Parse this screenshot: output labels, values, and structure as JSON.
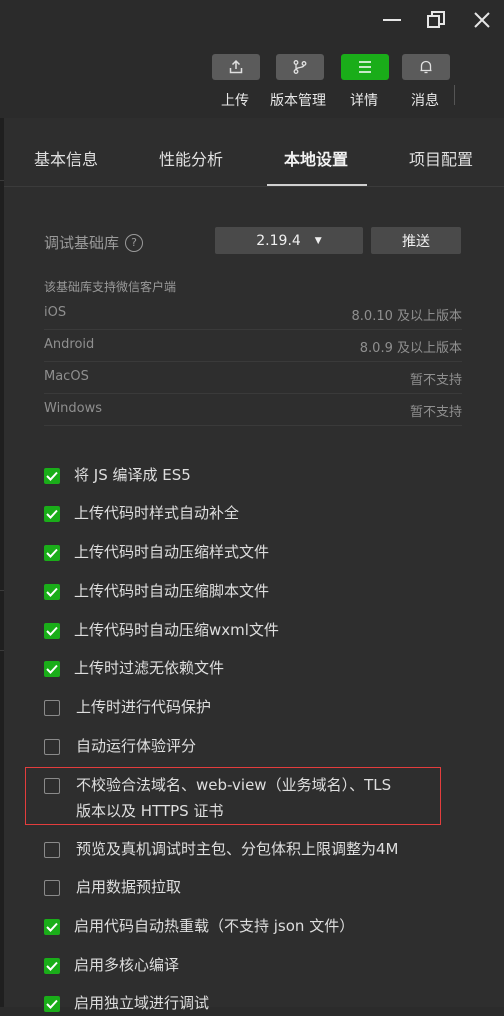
{
  "toolbar": {
    "upload_label": "上传",
    "version_label": "版本管理",
    "details_label": "详情",
    "messages_label": "消息"
  },
  "tabs": [
    "基本信息",
    "性能分析",
    "本地设置",
    "项目配置"
  ],
  "active_tab": "本地设置",
  "debug_lib": {
    "label": "调试基础库",
    "help": "?",
    "version": "2.19.4",
    "push_label": "推送"
  },
  "support": {
    "title": "该基础库支持微信客户端",
    "rows": [
      {
        "name": "iOS",
        "value": "8.0.10 及以上版本"
      },
      {
        "name": "Android",
        "value": "8.0.9 及以上版本"
      },
      {
        "name": "MacOS",
        "value": "暂不支持"
      },
      {
        "name": "Windows",
        "value": "暂不支持"
      }
    ]
  },
  "options": [
    {
      "label": "将 JS 编译成 ES5",
      "checked": true
    },
    {
      "label": "上传代码时样式自动补全",
      "checked": true
    },
    {
      "label": "上传代码时自动压缩样式文件",
      "checked": true
    },
    {
      "label": "上传代码时自动压缩脚本文件",
      "checked": true
    },
    {
      "label": "上传代码时自动压缩wxml文件",
      "checked": true
    },
    {
      "label": "上传时过滤无依赖文件",
      "checked": true
    },
    {
      "label": "上传时进行代码保护",
      "checked": false
    },
    {
      "label": "自动运行体验评分",
      "checked": false
    },
    {
      "label": "不校验合法域名、web-view（业务域名）、TLS",
      "label_line2": "版本以及 HTTPS 证书",
      "checked": false,
      "highlighted": true
    },
    {
      "label": "预览及真机调试时主包、分包体积上限调整为4M",
      "checked": false
    },
    {
      "label": "启用数据预拉取",
      "checked": false
    },
    {
      "label": "启用代码自动热重载（不支持 json 文件）",
      "checked": true
    },
    {
      "label": "启用多核心编译",
      "checked": true
    },
    {
      "label": "启用独立域进行调试",
      "checked": true
    }
  ],
  "colors": {
    "accent": "#1aad19",
    "highlight_border": "#e33d3d",
    "background": "#2e2e2e"
  }
}
